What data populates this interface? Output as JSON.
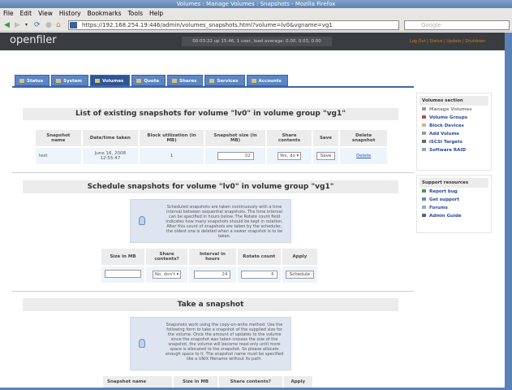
{
  "window": {
    "title": "Volumes : Manage Volumes : Snapshots - Mozilla Firefox"
  },
  "menu": [
    "File",
    "Edit",
    "View",
    "History",
    "Bookmarks",
    "Tools",
    "Help"
  ],
  "nav": {
    "url": "https://192.168.254.19:446/admin/volumes_snapshots.html?volume=lv0&vgname=vg1",
    "search_placeholder": "Google"
  },
  "header": {
    "logo": "openfiler",
    "uptime": "00:03:22 up 15:46, 1 user, load average: 0.00, 0.03, 0.00",
    "links": [
      "Log Out",
      "Status",
      "Update",
      "Shutdown"
    ]
  },
  "tabs": [
    "Status",
    "System",
    "Volumes",
    "Quota",
    "Shares",
    "Services",
    "Accounts"
  ],
  "list": {
    "title": "List of existing snapshots for volume \"lv0\" in volume group \"vg1\"",
    "headers": [
      "Snapshot name",
      "Date/time taken",
      "Block utilization (in MB)",
      "Snapshot size (in MB)",
      "Share contents",
      "Save",
      "Delete snapshot"
    ],
    "row": {
      "name": "test",
      "date": "June 16, 2008 12:55:47",
      "util": "1",
      "size": "32",
      "share": "Yes, do",
      "save": "Save",
      "delete": "Delete"
    }
  },
  "schedule": {
    "title": "Schedule snapshots for volume \"lv0\" in volume group \"vg1\"",
    "info": "Scheduled snapshots are taken continuously with a time interval between sequential snapshots. The time interval can be specified in hours below. The Rotate count field indicates how many snapshots should be kept in rotation. After this count of snapshots are taken by the scheduler, the oldest one is deleted when a newer snapshot is to be taken.",
    "headers": [
      "Size in MB",
      "Share contents?",
      "Interval in hours",
      "Rotate count",
      "Apply"
    ],
    "size": "",
    "share": "No, don't",
    "interval": "24",
    "rotate": "6",
    "button": "Schedule"
  },
  "take": {
    "title": "Take a snapshot",
    "info": "Snapshots work using the copy-on-write method. Use the following form to take a snapshot of the supplied size for the volume. Once the amount of updates to the volume since the snapshot was taken crosses the size of the snapshot, the volume will become read-only until more space is allocated to the snapshot. So please allocate enough space to it. The snapshot name must be specified like a UNIX filename without its path.",
    "headers": [
      "Snapshot name",
      "Size in MB",
      "Share contents?",
      "Apply"
    ]
  },
  "sidebar": {
    "volumes_title": "Volumes section",
    "volumes": [
      "Manage Volumes",
      "Volume Groups",
      "Block Devices",
      "Add Volume",
      "iSCSI Targets",
      "Software RAID"
    ],
    "support_title": "Support resources",
    "support": [
      "Report bug",
      "Get support",
      "Forums",
      "Admin Guide"
    ]
  }
}
